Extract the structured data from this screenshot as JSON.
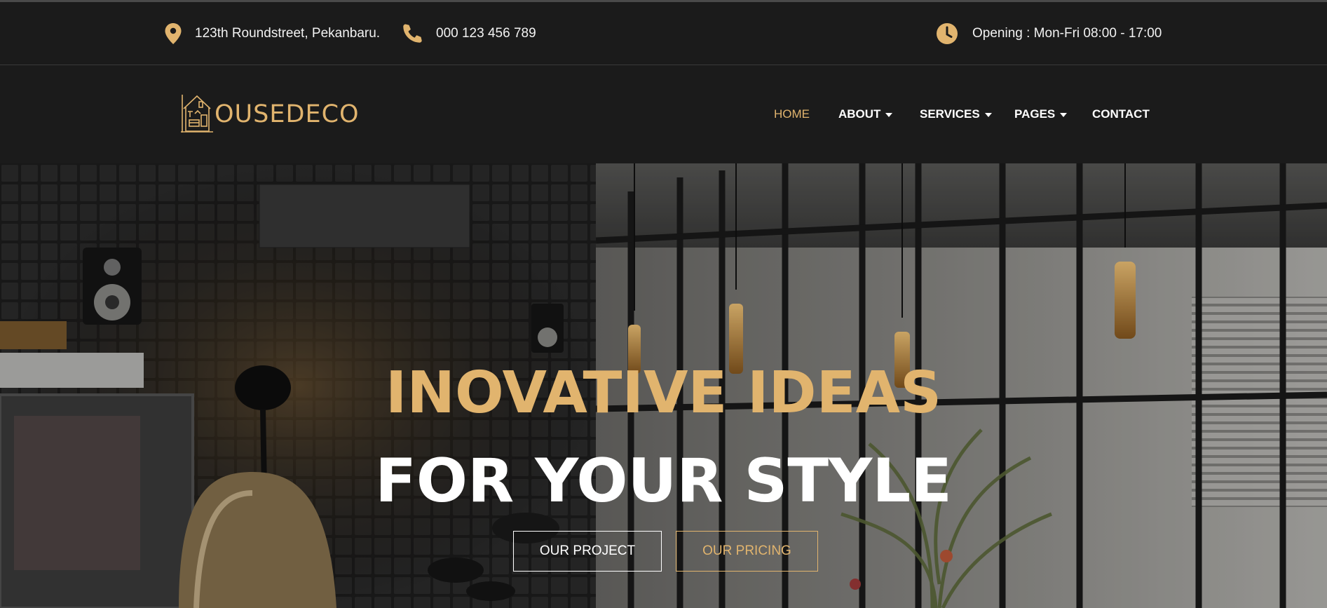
{
  "topbar": {
    "address": "123th Roundstreet, Pekanbaru.",
    "phone": "000 123 456 789",
    "hours": "Opening : Mon-Fri 08:00 - 17:00",
    "icons": {
      "address": "map-pin-icon",
      "phone": "phone-icon",
      "hours": "clock-icon"
    }
  },
  "brand": {
    "name": "OUSEDECO",
    "logo_icon": "house-sketch-icon"
  },
  "nav": {
    "items": [
      {
        "label": "HOME",
        "active": true,
        "dropdown": false
      },
      {
        "label": "ABOUT",
        "active": false,
        "dropdown": true
      },
      {
        "label": "SERVICES",
        "active": false,
        "dropdown": true
      },
      {
        "label": "PAGES",
        "active": false,
        "dropdown": true
      },
      {
        "label": "CONTACT",
        "active": false,
        "dropdown": false
      }
    ]
  },
  "hero": {
    "line1": "INOVATIVE IDEAS",
    "line2": "FOR YOUR STYLE",
    "buttons": {
      "project": "OUR PROJECT",
      "pricing": "OUR PRICING"
    }
  },
  "colors": {
    "accent": "#e1b46e",
    "background": "#1b1b1b",
    "text": "#ffffff"
  }
}
